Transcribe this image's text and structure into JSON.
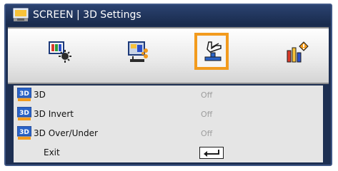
{
  "window": {
    "title": "SCREEN | 3D Settings",
    "title_icon": "screen-icon"
  },
  "tabs": [
    {
      "name": "image-tab",
      "icon": "image-settings-icon",
      "selected": false
    },
    {
      "name": "display-tab",
      "icon": "display-settings-icon",
      "selected": false
    },
    {
      "name": "setup-tab",
      "icon": "setup-settings-icon",
      "selected": true
    },
    {
      "name": "options-tab",
      "icon": "options-settings-icon",
      "selected": false
    }
  ],
  "menu": {
    "items": [
      {
        "label": "3D",
        "value": "Off",
        "icon": "3d-icon"
      },
      {
        "label": "3D Invert",
        "value": "Off",
        "icon": "3d-icon"
      },
      {
        "label": "3D Over/Under",
        "value": "Off",
        "icon": "3d-icon"
      }
    ],
    "exit": {
      "label": "Exit",
      "icon": "enter-icon"
    }
  },
  "colors": {
    "frame": "#1d2f52",
    "highlight": "#f29b1e",
    "content_bg": "#e5e5e5",
    "value_text": "#9d9d9d"
  }
}
